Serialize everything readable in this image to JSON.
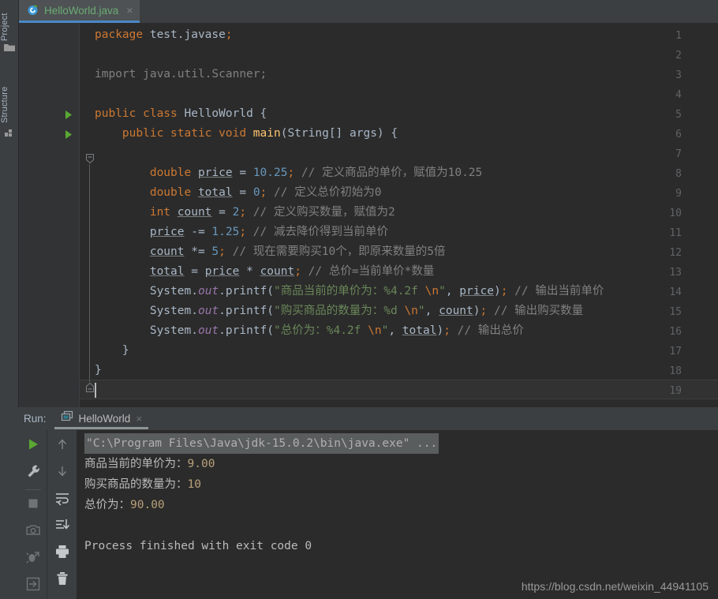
{
  "window": {
    "background": "#3c3f41",
    "editor_background": "#2b2b2b"
  },
  "left_strip": {
    "project_label": "Project",
    "structure_label": "Structure",
    "folder_icon": "folder-icon",
    "structure_icon": "structure-icon"
  },
  "editor_tab": {
    "label": "HelloWorld.java",
    "icon": "java-class-icon",
    "close": "×",
    "label_color": "#6aab73",
    "underline_color": "#4a88c7"
  },
  "editor": {
    "line_numbers": [
      "1",
      "2",
      "3",
      "4",
      "5",
      "6",
      "7",
      "8",
      "9",
      "10",
      "11",
      "12",
      "13",
      "14",
      "15",
      "16",
      "17",
      "18",
      "19"
    ],
    "run_marker_lines": [
      5,
      6
    ],
    "current_line": 19,
    "lines": [
      {
        "n": 1,
        "tokens": [
          {
            "t": "package ",
            "c": "kw"
          },
          {
            "t": "test.javase",
            "c": "typ"
          },
          {
            "t": ";",
            "c": "sem"
          }
        ]
      },
      {
        "n": 2,
        "tokens": []
      },
      {
        "n": 3,
        "tokens": [
          {
            "t": "import ",
            "c": "cmt"
          },
          {
            "t": "java.util.Scanner",
            "c": "cmt"
          },
          {
            "t": ";",
            "c": "cmt"
          }
        ]
      },
      {
        "n": 4,
        "tokens": []
      },
      {
        "n": 5,
        "tokens": [
          {
            "t": "public ",
            "c": "kw"
          },
          {
            "t": "class ",
            "c": "kw"
          },
          {
            "t": "HelloWorld",
            "c": "cls"
          },
          {
            "t": " {",
            "c": "pun"
          }
        ]
      },
      {
        "n": 6,
        "tokens": [
          {
            "t": "    ",
            "c": "pun"
          },
          {
            "t": "public ",
            "c": "kw"
          },
          {
            "t": "static ",
            "c": "kw"
          },
          {
            "t": "void ",
            "c": "kw"
          },
          {
            "t": "main",
            "c": "mth"
          },
          {
            "t": "(String[] args) {",
            "c": "pun"
          }
        ]
      },
      {
        "n": 7,
        "tokens": []
      },
      {
        "n": 8,
        "tokens": [
          {
            "t": "        ",
            "c": "pun"
          },
          {
            "t": "double ",
            "c": "kw"
          },
          {
            "t": "price",
            "c": "var"
          },
          {
            "t": " = ",
            "c": "pun"
          },
          {
            "t": "10.25",
            "c": "num"
          },
          {
            "t": ";",
            "c": "sem"
          },
          {
            "t": " // 定义商品的单价，赋值为10.25",
            "c": "cmt"
          }
        ]
      },
      {
        "n": 9,
        "tokens": [
          {
            "t": "        ",
            "c": "pun"
          },
          {
            "t": "double ",
            "c": "kw"
          },
          {
            "t": "total",
            "c": "var"
          },
          {
            "t": " = ",
            "c": "pun"
          },
          {
            "t": "0",
            "c": "num"
          },
          {
            "t": ";",
            "c": "sem"
          },
          {
            "t": " // 定义总价初始为0",
            "c": "cmt"
          }
        ]
      },
      {
        "n": 10,
        "tokens": [
          {
            "t": "        ",
            "c": "pun"
          },
          {
            "t": "int ",
            "c": "kw"
          },
          {
            "t": "count",
            "c": "var"
          },
          {
            "t": " = ",
            "c": "pun"
          },
          {
            "t": "2",
            "c": "num"
          },
          {
            "t": ";",
            "c": "sem"
          },
          {
            "t": " // 定义购买数量，赋值为2",
            "c": "cmt"
          }
        ]
      },
      {
        "n": 11,
        "tokens": [
          {
            "t": "        ",
            "c": "pun"
          },
          {
            "t": "price",
            "c": "var"
          },
          {
            "t": " -= ",
            "c": "pun"
          },
          {
            "t": "1.25",
            "c": "num"
          },
          {
            "t": ";",
            "c": "sem"
          },
          {
            "t": " // 减去降价得到当前单价",
            "c": "cmt"
          }
        ]
      },
      {
        "n": 12,
        "tokens": [
          {
            "t": "        ",
            "c": "pun"
          },
          {
            "t": "count",
            "c": "var"
          },
          {
            "t": " *= ",
            "c": "pun"
          },
          {
            "t": "5",
            "c": "num"
          },
          {
            "t": ";",
            "c": "sem"
          },
          {
            "t": " // 现在需要购买10个，即原来数量的5倍",
            "c": "cmt"
          }
        ]
      },
      {
        "n": 13,
        "tokens": [
          {
            "t": "        ",
            "c": "pun"
          },
          {
            "t": "total",
            "c": "var"
          },
          {
            "t": " = ",
            "c": "pun"
          },
          {
            "t": "price",
            "c": "var"
          },
          {
            "t": " * ",
            "c": "pun"
          },
          {
            "t": "count",
            "c": "var"
          },
          {
            "t": ";",
            "c": "sem"
          },
          {
            "t": " // 总价=当前单价*数量",
            "c": "cmt"
          }
        ]
      },
      {
        "n": 14,
        "tokens": [
          {
            "t": "        ",
            "c": "pun"
          },
          {
            "t": "System",
            "c": "typ"
          },
          {
            "t": ".",
            "c": "pun"
          },
          {
            "t": "out",
            "c": "fld"
          },
          {
            "t": ".printf(",
            "c": "pun"
          },
          {
            "t": "\"商品当前的单价为：%4.2f ",
            "c": "str"
          },
          {
            "t": "\\n",
            "c": "esc"
          },
          {
            "t": "\"",
            "c": "str"
          },
          {
            "t": ", ",
            "c": "pun"
          },
          {
            "t": "price",
            "c": "var"
          },
          {
            "t": ")",
            "c": "pun"
          },
          {
            "t": ";",
            "c": "sem"
          },
          {
            "t": " // 输出当前单价",
            "c": "cmt"
          }
        ]
      },
      {
        "n": 15,
        "tokens": [
          {
            "t": "        ",
            "c": "pun"
          },
          {
            "t": "System",
            "c": "typ"
          },
          {
            "t": ".",
            "c": "pun"
          },
          {
            "t": "out",
            "c": "fld"
          },
          {
            "t": ".printf(",
            "c": "pun"
          },
          {
            "t": "\"购买商品的数量为：%d ",
            "c": "str"
          },
          {
            "t": "\\n",
            "c": "esc"
          },
          {
            "t": "\"",
            "c": "str"
          },
          {
            "t": ", ",
            "c": "pun"
          },
          {
            "t": "count",
            "c": "var"
          },
          {
            "t": ")",
            "c": "pun"
          },
          {
            "t": ";",
            "c": "sem"
          },
          {
            "t": " // 输出购买数量",
            "c": "cmt"
          }
        ]
      },
      {
        "n": 16,
        "tokens": [
          {
            "t": "        ",
            "c": "pun"
          },
          {
            "t": "System",
            "c": "typ"
          },
          {
            "t": ".",
            "c": "pun"
          },
          {
            "t": "out",
            "c": "fld"
          },
          {
            "t": ".printf(",
            "c": "pun"
          },
          {
            "t": "\"总价为：%4.2f ",
            "c": "str"
          },
          {
            "t": "\\n",
            "c": "esc"
          },
          {
            "t": "\"",
            "c": "str"
          },
          {
            "t": ", ",
            "c": "pun"
          },
          {
            "t": "total",
            "c": "var"
          },
          {
            "t": ")",
            "c": "pun"
          },
          {
            "t": ";",
            "c": "sem"
          },
          {
            "t": " // 输出总价",
            "c": "cmt"
          }
        ]
      },
      {
        "n": 17,
        "tokens": [
          {
            "t": "    }",
            "c": "pun"
          }
        ]
      },
      {
        "n": 18,
        "tokens": [
          {
            "t": "}",
            "c": "pun"
          }
        ]
      },
      {
        "n": 19,
        "tokens": []
      }
    ]
  },
  "run_panel": {
    "run_label": "Run:",
    "tab_label": "HelloWorld",
    "tab_icon": "run-config-icon",
    "tab_close": "×",
    "toolbar_left": [
      {
        "name": "rerun-icon",
        "glyph": "play"
      },
      {
        "name": "settings-wrench-icon",
        "glyph": "wrench"
      },
      {
        "name": "stop-icon",
        "glyph": "stop"
      },
      {
        "name": "camera-icon",
        "glyph": "camera"
      },
      {
        "name": "dump-threads-icon",
        "glyph": "bug"
      },
      {
        "name": "exit-icon",
        "glyph": "exit"
      }
    ],
    "toolbar_right": [
      {
        "name": "up-arrow-icon",
        "glyph": "up"
      },
      {
        "name": "down-arrow-icon",
        "glyph": "down"
      },
      {
        "name": "soft-wrap-icon",
        "glyph": "wrap"
      },
      {
        "name": "scroll-to-end-icon",
        "glyph": "scrollend"
      },
      {
        "name": "print-icon",
        "glyph": "print"
      },
      {
        "name": "clear-all-icon",
        "glyph": "trash"
      }
    ],
    "console": [
      {
        "type": "cmd",
        "text": "\"C:\\Program Files\\Java\\jdk-15.0.2\\bin\\java.exe\" ..."
      },
      {
        "type": "out",
        "text": "商品当前的单价为：",
        "num": "9.00"
      },
      {
        "type": "out",
        "text": "购买商品的数量为：",
        "num": "10"
      },
      {
        "type": "out",
        "text": "总价为：",
        "num": "90.00"
      },
      {
        "type": "blank",
        "text": ""
      },
      {
        "type": "plain",
        "text": "Process finished with exit code 0"
      }
    ]
  },
  "watermark": "https://blog.csdn.net/weixin_44941105"
}
